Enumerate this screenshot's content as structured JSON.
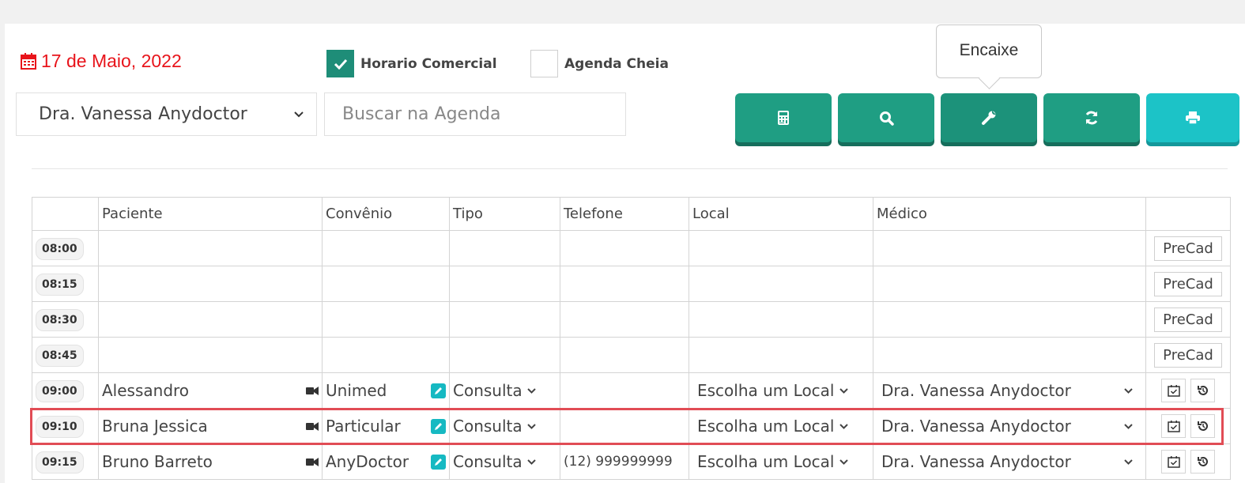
{
  "header": {
    "date": "17 de Maio, 2022",
    "horario_comercial": "Horario Comercial",
    "agenda_cheia": "Agenda Cheia",
    "doctor_select": "Dra. Vanessa Anydoctor",
    "search_placeholder": "Buscar na Agenda",
    "tooltip": "Encaixe"
  },
  "colors": {
    "date": "#e8141b",
    "primary_button": "#1f9e83",
    "print_button": "#1cc3c7",
    "highlight": "#e14c55"
  },
  "toolbar_icons": [
    "calculator-icon",
    "search-icon",
    "wrench-icon",
    "refresh-icon",
    "print-icon"
  ],
  "table": {
    "columns": [
      "",
      "Paciente",
      "Convênio",
      "Tipo",
      "Telefone",
      "Local",
      "Médico",
      ""
    ],
    "empty_rows": [
      {
        "time": "08:00",
        "action": "PreCad"
      },
      {
        "time": "08:15",
        "action": "PreCad"
      },
      {
        "time": "08:30",
        "action": "PreCad"
      },
      {
        "time": "08:45",
        "action": "PreCad"
      }
    ],
    "rows": [
      {
        "time": "09:00",
        "paciente": "Alessandro",
        "convenio": "Unimed",
        "tipo": "Consulta",
        "telefone": "",
        "local": "Escolha um Local",
        "medico": "Dra. Vanessa Anydoctor"
      },
      {
        "time": "09:10",
        "paciente": "Bruna Jessica",
        "convenio": "Particular",
        "tipo": "Consulta",
        "telefone": "",
        "local": "Escolha um Local",
        "medico": "Dra. Vanessa Anydoctor"
      },
      {
        "time": "09:15",
        "paciente": "Bruno Barreto",
        "convenio": "AnyDoctor",
        "tipo": "Consulta",
        "telefone": "(12) 999999999",
        "local": "Escolha um Local",
        "medico": "Dra. Vanessa Anydoctor"
      }
    ]
  }
}
